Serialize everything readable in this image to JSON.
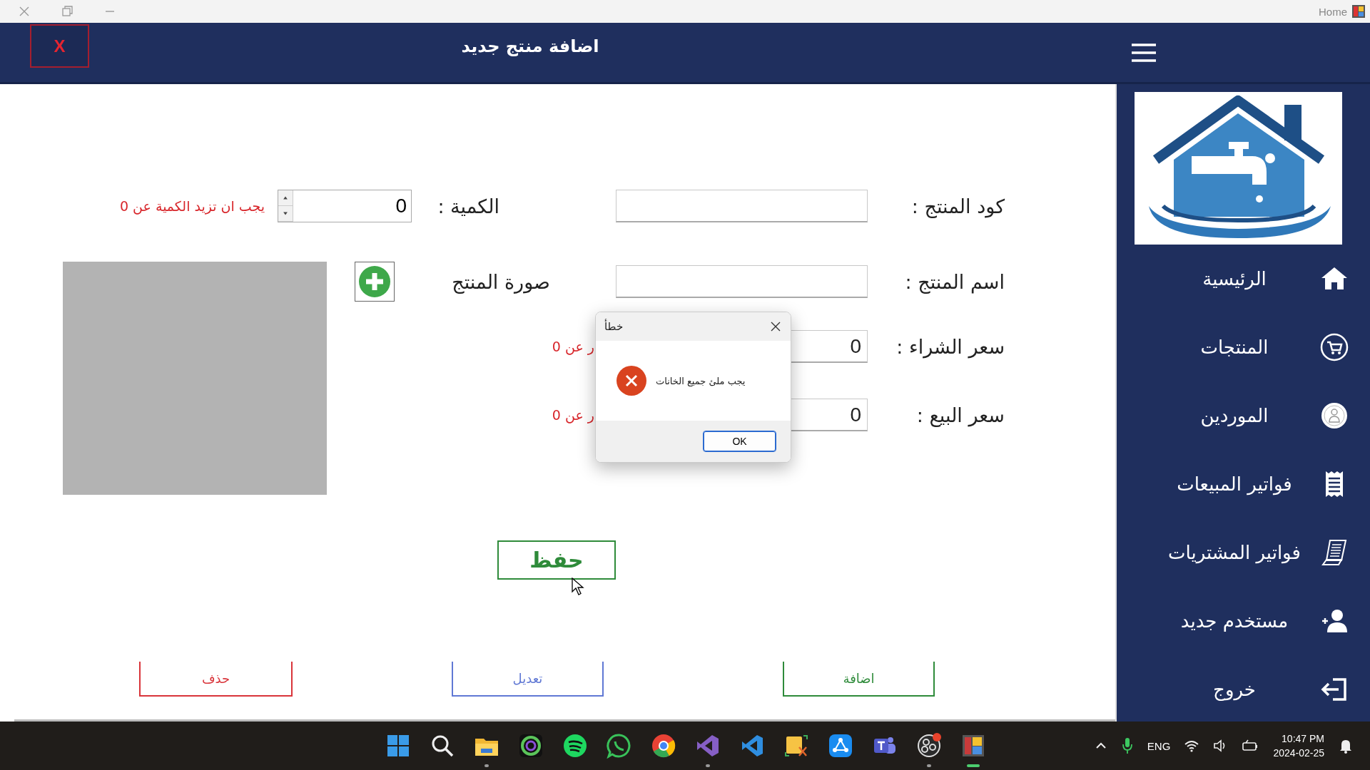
{
  "window": {
    "title": "Home"
  },
  "header": {
    "title": "اضافة منتج جديد",
    "close_label": "X"
  },
  "form": {
    "quantity": {
      "label": "الكمية :",
      "value": "0",
      "error": "يجب ان تزيد الكمية عن 0"
    },
    "image": {
      "label": "صورة المنتج"
    },
    "fields": [
      {
        "label": "كود المنتج :"
      },
      {
        "label": "اسم المنتج :"
      },
      {
        "label": "سعر الشراء :",
        "value": "0",
        "error": "ر عن 0"
      },
      {
        "label": "سعر البيع :",
        "value": "0",
        "error": "ر عن 0"
      }
    ],
    "save_button": "حفظ"
  },
  "actions": [
    {
      "label": "اضافة",
      "kind": "add"
    },
    {
      "label": "تعديل",
      "kind": "edit"
    },
    {
      "label": "حذف",
      "kind": "delete"
    }
  ],
  "sidebar": {
    "items": [
      {
        "label": "الرئيسية"
      },
      {
        "label": "المنتجات"
      },
      {
        "label": "الموردين"
      },
      {
        "label": "فواتير المبيعات"
      },
      {
        "label": "فواتير المشتريات"
      },
      {
        "label": "مستخدم جديد"
      },
      {
        "label": "خروج"
      }
    ]
  },
  "dialog": {
    "title": "خطأ",
    "message": "يجب ملئ جميع الخانات",
    "button": "OK"
  },
  "taskbar": {
    "apps": [
      {
        "running": false,
        "active": false
      },
      {
        "running": false,
        "active": false
      },
      {
        "running": true,
        "active": false
      },
      {
        "running": false,
        "active": false
      },
      {
        "running": false,
        "active": false
      },
      {
        "running": false,
        "active": false
      },
      {
        "running": false,
        "active": false
      },
      {
        "running": true,
        "active": false
      },
      {
        "running": false,
        "active": false
      },
      {
        "running": false,
        "active": false
      },
      {
        "running": false,
        "active": false
      },
      {
        "running": false,
        "active": false
      },
      {
        "running": true,
        "active": false
      },
      {
        "running": true,
        "active": true
      }
    ],
    "language": "ENG",
    "time": "10:47 PM",
    "date": "2024-02-25"
  }
}
